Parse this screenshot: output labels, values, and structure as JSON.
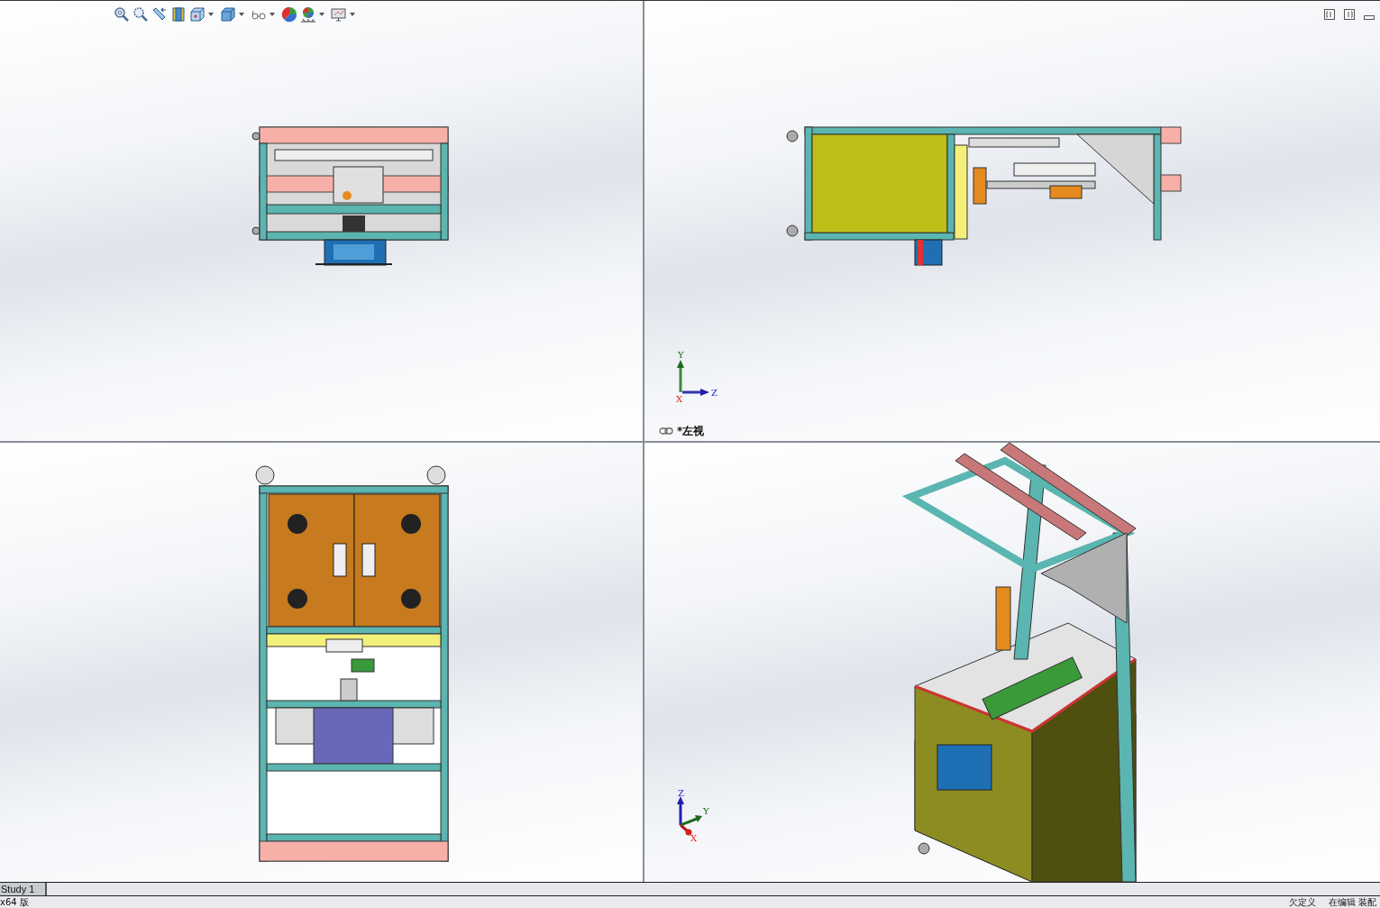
{
  "toolbar": [
    {
      "kind": "zoom-fit",
      "dropdown": false
    },
    {
      "kind": "zoom-area",
      "dropdown": false
    },
    {
      "kind": "previous-view",
      "dropdown": false
    },
    {
      "kind": "section-view",
      "dropdown": false
    },
    {
      "kind": "view-orientation",
      "dropdown": true
    },
    {
      "kind": "display-style",
      "dropdown": true
    },
    {
      "kind": "hide-show",
      "dropdown": true
    },
    {
      "kind": "appearance",
      "dropdown": false
    },
    {
      "kind": "scene",
      "dropdown": true
    },
    {
      "kind": "view-settings",
      "dropdown": true
    }
  ],
  "viewports": [
    {
      "kind": "top"
    },
    {
      "kind": "left",
      "label": "*左视",
      "triad": [
        "Y",
        "Z",
        "X"
      ]
    },
    {
      "kind": "front"
    },
    {
      "kind": "iso",
      "triad": [
        "Z",
        "Y",
        "X"
      ]
    }
  ],
  "tabs": [
    {
      "label": "Study 1",
      "selected": true
    }
  ],
  "status_bar": {
    "left": "x64 版",
    "right": [
      "欠定义",
      "在编辑 装配"
    ]
  }
}
